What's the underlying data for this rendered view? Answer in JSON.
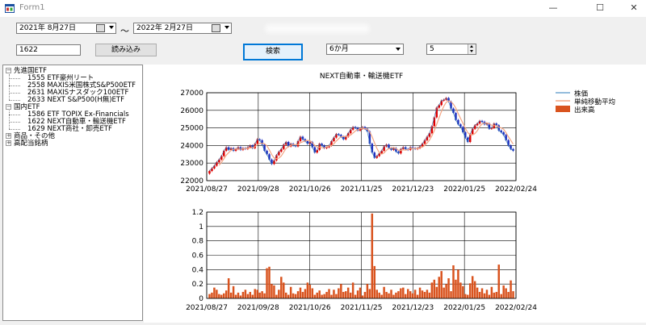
{
  "window": {
    "title": "Form1",
    "minimize": "—",
    "maximize": "☐",
    "close": "✕"
  },
  "toolbar": {
    "date_from": "2021年  8月27日",
    "date_to": "2022年  2月27日",
    "separator": "～",
    "code_value": "1622",
    "load_button": "読み込み",
    "search_button": "検索",
    "period_select": "6か月",
    "ma_spinner": "5"
  },
  "tree": [
    {
      "label": "先進国ETF",
      "expanded": true,
      "children": [
        "1555 ETF豪州リート",
        "2558 MAXIS米国株式S&P500ETF",
        "2631 MAXISナスダック100ETF",
        "2633 NEXT S&P500(H無)ETF"
      ]
    },
    {
      "label": "国内ETF",
      "expanded": true,
      "children": [
        "1586 ETF TOPIX Ex-Financials",
        "1622 NEXT自動車・輸送機ETF",
        "1629 NEXT商社・卸売ETF"
      ]
    },
    {
      "label": "商品・その他",
      "expanded": false,
      "children": []
    },
    {
      "label": "高配当銘柄",
      "expanded": false,
      "children": []
    }
  ],
  "colors": {
    "up": "#dd0000",
    "down": "#1f2fbf",
    "ma": "#f4a582",
    "price_line": "#2a7ab8",
    "volume": "#d9531e"
  },
  "icons": {
    "app": "form-app-icon",
    "calendar": "calendar-icon",
    "dropdown": "chevron-down-icon",
    "tree_expand": "plus-minus-icon"
  },
  "chart_data": [
    {
      "type": "candlestick",
      "title": "NEXT自動車・輸送機ETF",
      "legend": [
        "株価",
        "単純移動平均",
        "出来高"
      ],
      "legend_position": "right",
      "grid": true,
      "ylim": [
        22000,
        27000
      ],
      "yticks": [
        22000,
        23000,
        24000,
        25000,
        26000,
        27000
      ],
      "x_tick_labels": [
        "2021/08/27",
        "2021/09/28",
        "2021/10/26",
        "2021/11/25",
        "2021/12/23",
        "2022/01/25",
        "2022/02/24"
      ],
      "close": [
        22550,
        22700,
        22850,
        23050,
        23200,
        23400,
        23700,
        23900,
        23750,
        23850,
        23700,
        23800,
        23900,
        23750,
        23850,
        23800,
        23900,
        24000,
        23850,
        24100,
        24350,
        24300,
        24050,
        23700,
        23500,
        23200,
        22950,
        23150,
        23450,
        23650,
        23800,
        24050,
        24200,
        23950,
        24100,
        24000,
        23950,
        24250,
        24500,
        24350,
        24250,
        24100,
        24200,
        23900,
        23600,
        23750,
        24100,
        24000,
        23850,
        23900,
        24000,
        24250,
        24450,
        24650,
        24600,
        24500,
        24350,
        24500,
        24700,
        24900,
        25050,
        25000,
        24850,
        24950,
        25050,
        24950,
        24800,
        24100,
        23600,
        23300,
        23400,
        23550,
        23700,
        23950,
        24050,
        23850,
        23750,
        23850,
        23650,
        23550,
        23800,
        23900,
        23800,
        23750,
        23900,
        23850,
        23800,
        23850,
        23950,
        24100,
        24300,
        24500,
        24700,
        25100,
        25600,
        26150,
        26300,
        26550,
        26600,
        26700,
        26500,
        26100,
        25850,
        25450,
        25200,
        25050,
        24750,
        24450,
        24200,
        24650,
        24950,
        25150,
        25250,
        25400,
        25350,
        25200,
        25250,
        24950,
        25000,
        25250,
        25150,
        24850,
        24750,
        24600,
        24300,
        24000,
        23800,
        23700
      ],
      "sma_period": 5,
      "volume": {
        "ylim": [
          0,
          1.2
        ],
        "yticks": [
          0,
          0.2,
          0.4,
          0.6,
          0.8,
          1,
          1.2
        ],
        "values": [
          0.06,
          0.08,
          0.15,
          0.12,
          0.06,
          0.05,
          0.07,
          0.11,
          0.28,
          0.08,
          0.17,
          0.05,
          0.08,
          0.04,
          0.09,
          0.12,
          0.06,
          0.09,
          0.05,
          0.13,
          0.12,
          0.08,
          0.1,
          0.07,
          0.42,
          0.44,
          0.2,
          0.18,
          0.05,
          0.12,
          0.3,
          0.22,
          0.08,
          0.05,
          0.16,
          0.07,
          0.06,
          0.1,
          0.15,
          0.09,
          0.13,
          0.22,
          0.19,
          0.14,
          0.05,
          0.08,
          0.11,
          0.05,
          0.06,
          0.09,
          0.13,
          0.05,
          0.12,
          0.06,
          0.14,
          0.2,
          0.09,
          0.1,
          0.15,
          0.08,
          0.22,
          0.05,
          0.11,
          0.15,
          0.04,
          0.09,
          0.2,
          0.13,
          1.18,
          0.45,
          0.12,
          0.08,
          0.05,
          0.16,
          0.09,
          0.07,
          0.12,
          0.05,
          0.08,
          0.1,
          0.14,
          0.15,
          0.06,
          0.13,
          0.1,
          0.07,
          0.12,
          0.05,
          0.15,
          0.11,
          0.09,
          0.12,
          0.08,
          0.22,
          0.26,
          0.16,
          0.3,
          0.38,
          0.15,
          0.2,
          0.28,
          0.1,
          0.46,
          0.26,
          0.4,
          0.22,
          0.17,
          0.06,
          0.05,
          0.21,
          0.31,
          0.24,
          0.15,
          0.09,
          0.14,
          0.07,
          0.12,
          0.05,
          0.16,
          0.08,
          0.09,
          0.47,
          0.06,
          0.18,
          0.14,
          0.09,
          0.25,
          0.1
        ]
      }
    }
  ]
}
